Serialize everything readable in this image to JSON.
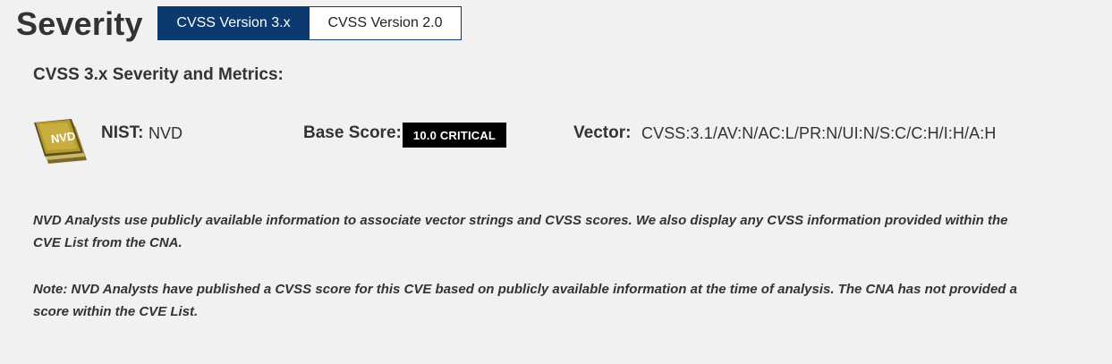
{
  "section": {
    "title": "Severity"
  },
  "tabs": [
    {
      "label": "CVSS Version 3.x",
      "active": true
    },
    {
      "label": "CVSS Version 2.0",
      "active": false
    }
  ],
  "metrics": {
    "heading": "CVSS 3.x Severity and Metrics:",
    "logo_icon": "nvd-logo-icon",
    "logo_text": "NVD",
    "nist_label": "NIST:",
    "nist_value": "NVD",
    "base_score_label": "Base Score:",
    "base_score_value": "10.0 CRITICAL",
    "vector_label": "Vector:",
    "vector_value": "CVSS:3.1/AV:N/AC:L/PR:N/UI:N/S:C/C:H/I:H/A:H"
  },
  "notes": [
    "NVD Analysts use publicly available information to associate vector strings and CVSS scores. We also display any CVSS information provided within the CVE List from the CNA.",
    "Note: NVD Analysts have published a CVSS score for this CVE based on publicly available information at the time of analysis. The CNA has not provided a score within the CVE List."
  ],
  "colors": {
    "background": "#f1f1f1",
    "tab_active_bg": "#0d3a6e",
    "critical_badge_bg": "#000000",
    "logo_gold": "#b59a2d"
  }
}
